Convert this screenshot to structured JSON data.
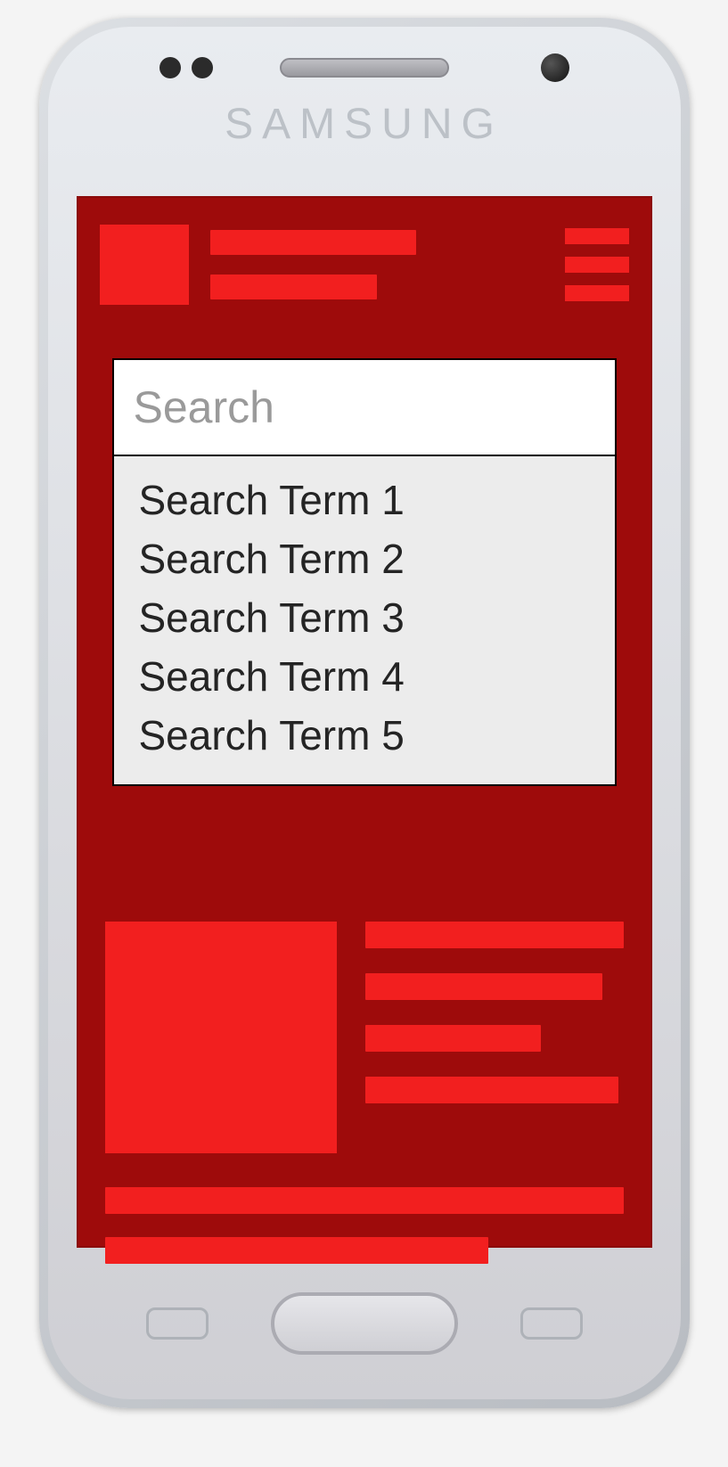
{
  "brand_label": "SAMSUNG",
  "search": {
    "placeholder": "Search",
    "value": "",
    "suggestions": [
      "Search Term 1",
      "Search Term 2",
      "Search Term 3",
      "Search Term 4",
      "Search Term 5"
    ]
  },
  "colors": {
    "screen_bg": "#9e0b0b",
    "accent": "#f21f1f",
    "panel_bg": "#ececec",
    "input_bg": "#ffffff"
  }
}
